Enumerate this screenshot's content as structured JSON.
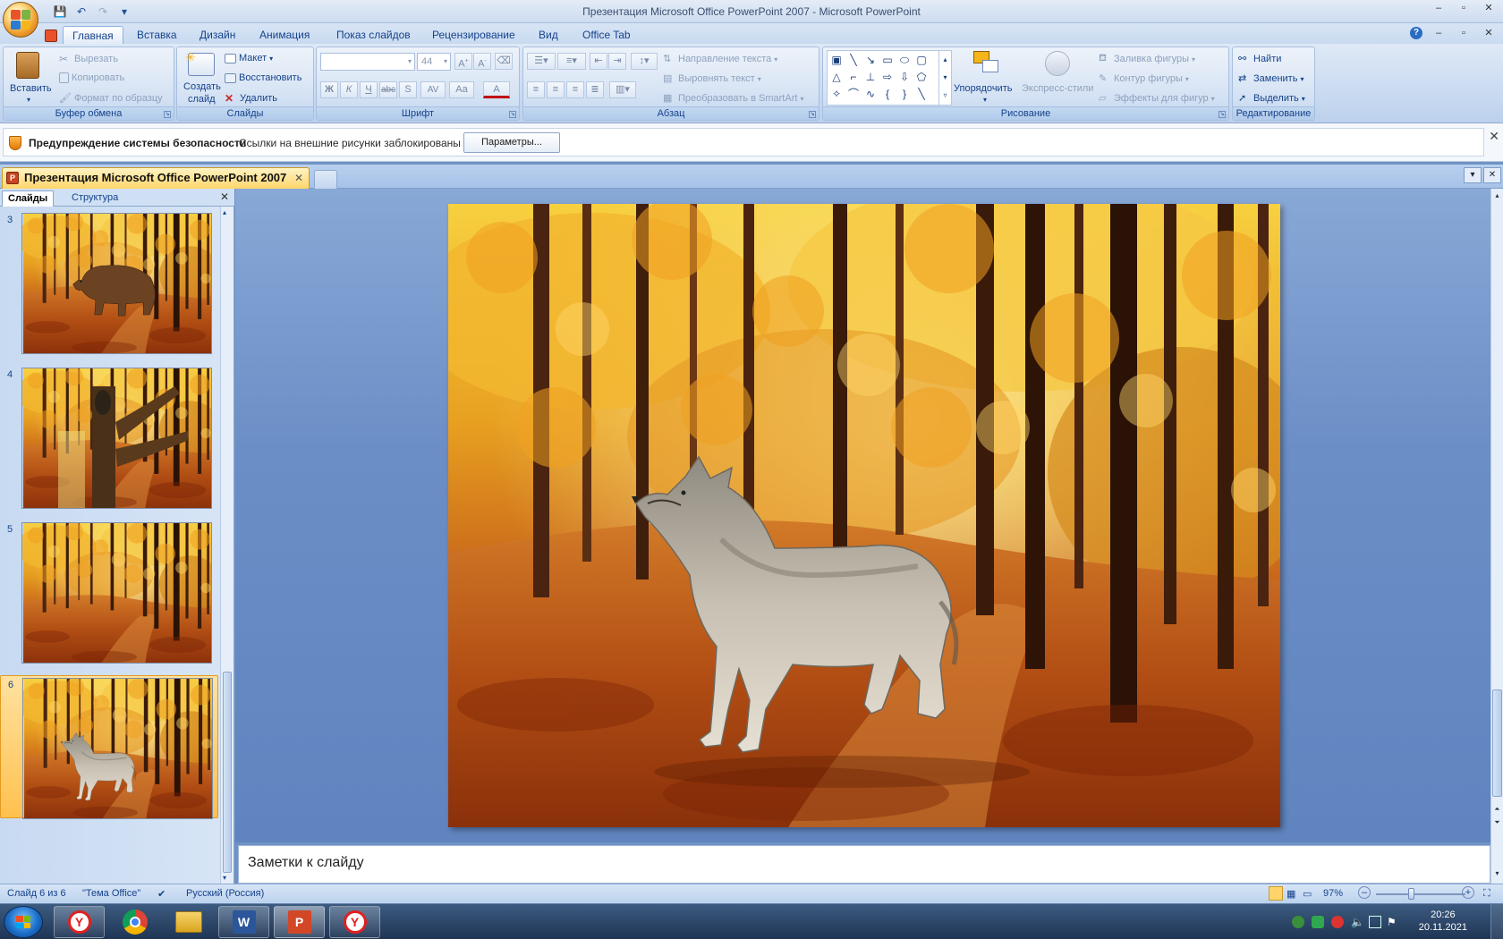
{
  "window": {
    "title": "Презентация Microsoft Office PowerPoint 2007 - Microsoft PowerPoint"
  },
  "ribbon_tabs": [
    "Главная",
    "Вставка",
    "Дизайн",
    "Анимация",
    "Показ слайдов",
    "Рецензирование",
    "Вид",
    "Office Tab"
  ],
  "ribbon": {
    "clipboard": {
      "label": "Буфер обмена",
      "paste": "Вставить",
      "cut": "Вырезать",
      "copy": "Копировать",
      "format_painter": "Формат по образцу"
    },
    "slides": {
      "label": "Слайды",
      "new_slide_line1": "Создать",
      "new_slide_line2": "слайд",
      "layout": "Макет",
      "reset": "Восстановить",
      "delete": "Удалить"
    },
    "font": {
      "label": "Шрифт",
      "font_name": "",
      "font_size": "44",
      "bold": "Ж",
      "italic": "К",
      "underline": "Ч",
      "strike": "abc",
      "shadow": "S",
      "spacing": "AV",
      "case": "Aa",
      "color": "A"
    },
    "paragraph": {
      "label": "Абзац",
      "text_direction": "Направление текста",
      "align_text": "Выровнять текст",
      "smartart": "Преобразовать в SmartArt"
    },
    "drawing": {
      "label": "Рисование",
      "arrange": "Упорядочить",
      "quick_styles": "Экспресс-стили",
      "shape_fill": "Заливка фигуры",
      "shape_outline": "Контур фигуры",
      "shape_effects": "Эффекты для фигур"
    },
    "editing": {
      "label": "Редактирование",
      "find": "Найти",
      "replace": "Заменить",
      "select": "Выделить"
    }
  },
  "security_bar": {
    "title": "Предупреждение системы безопасности",
    "message": "Ссылки на внешние рисунки заблокированы",
    "button": "Параметры..."
  },
  "doc_tab": {
    "title": "Презентация Microsoft Office PowerPoint 2007"
  },
  "left_panel": {
    "tabs": [
      "Слайды",
      "Структура"
    ],
    "thumbnails": [
      {
        "num": "3",
        "content": "bear"
      },
      {
        "num": "4",
        "content": "tree-owl"
      },
      {
        "num": "5",
        "content": "forest"
      },
      {
        "num": "6",
        "content": "wolf",
        "selected": true
      }
    ]
  },
  "notes": {
    "placeholder": "Заметки к слайду"
  },
  "status": {
    "slide": "Слайд 6 из 6",
    "theme": "\"Тема Office\"",
    "language": "Русский (Россия)",
    "zoom": "97%",
    "zoom_level": 0.4
  },
  "taskbar": {
    "time": "20:26",
    "date": "20.11.2021",
    "apps": [
      "yandex-browser",
      "chrome",
      "explorer",
      "word",
      "powerpoint",
      "yandex-browser"
    ]
  },
  "colors": {
    "ribbon": "#c7d9f0",
    "accent": "#15428b",
    "selected_thumb": "#ffc14f"
  }
}
